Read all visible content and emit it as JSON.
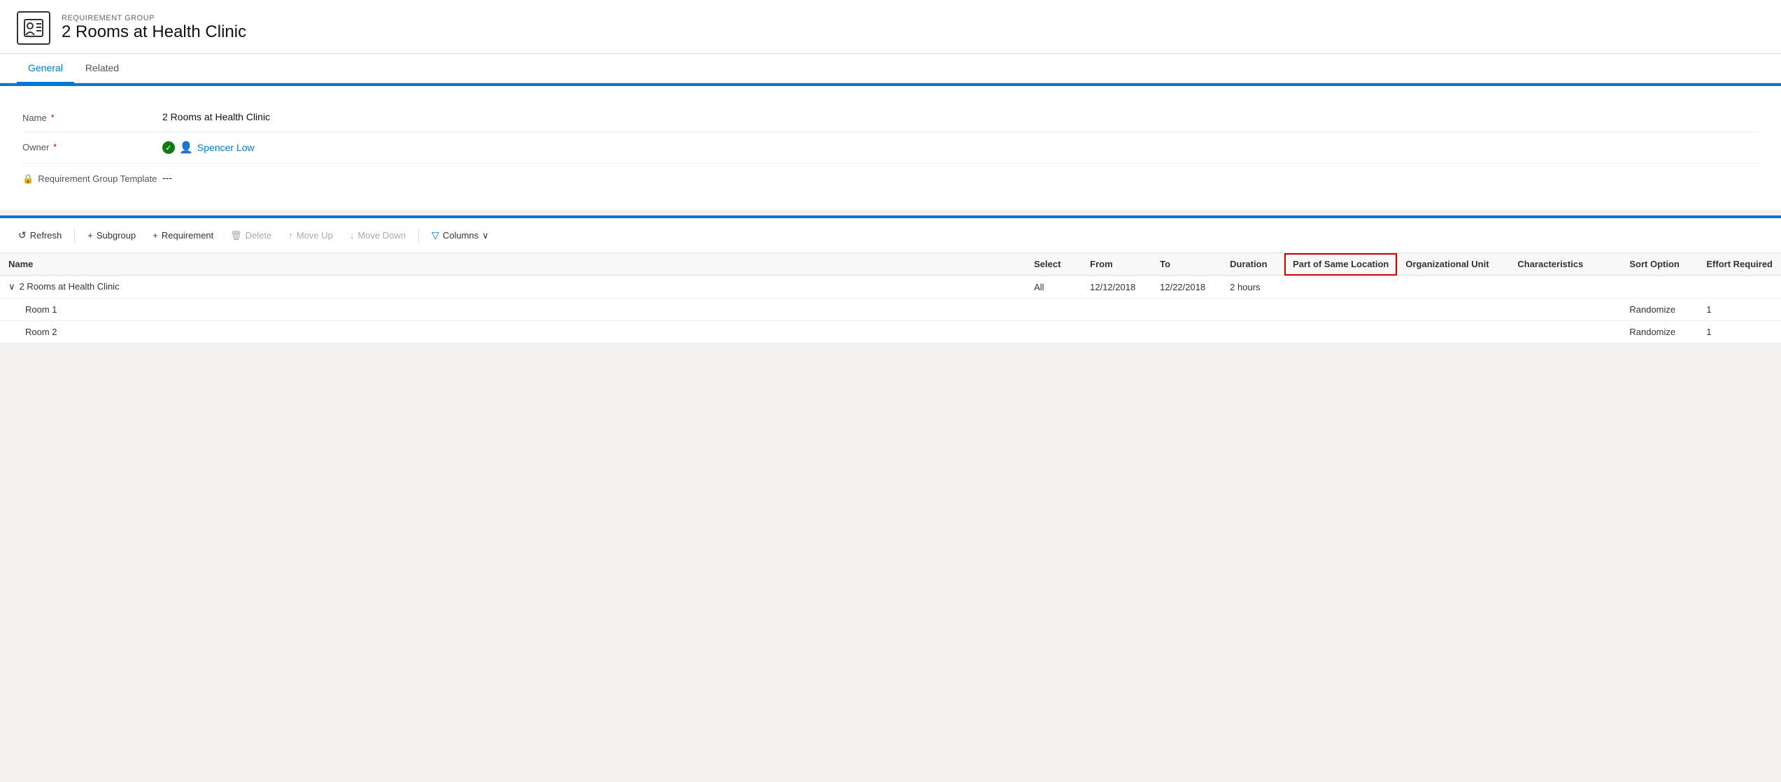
{
  "header": {
    "subtitle": "REQUIREMENT GROUP",
    "title": "2 Rooms at Health Clinic"
  },
  "tabs": [
    {
      "label": "General",
      "active": true
    },
    {
      "label": "Related",
      "active": false
    }
  ],
  "form": {
    "fields": [
      {
        "label": "Name",
        "required": true,
        "lock": false,
        "value": "2 Rooms at Health Clinic",
        "type": "text"
      },
      {
        "label": "Owner",
        "required": true,
        "lock": false,
        "value": "Spencer Low",
        "type": "link"
      },
      {
        "label": "Requirement Group Template",
        "required": false,
        "lock": true,
        "value": "---",
        "type": "text"
      }
    ]
  },
  "toolbar": {
    "refresh_label": "Refresh",
    "subgroup_label": "Subgroup",
    "requirement_label": "Requirement",
    "delete_label": "Delete",
    "moveup_label": "Move Up",
    "movedown_label": "Move Down",
    "columns_label": "Columns"
  },
  "grid": {
    "columns": [
      {
        "id": "name",
        "label": "Name",
        "highlighted": false
      },
      {
        "id": "select",
        "label": "Select",
        "highlighted": false
      },
      {
        "id": "from",
        "label": "From",
        "highlighted": false
      },
      {
        "id": "to",
        "label": "To",
        "highlighted": false
      },
      {
        "id": "duration",
        "label": "Duration",
        "highlighted": false
      },
      {
        "id": "partofsame",
        "label": "Part of Same Location",
        "highlighted": true
      },
      {
        "id": "orgunit",
        "label": "Organizational Unit",
        "highlighted": false
      },
      {
        "id": "characteristics",
        "label": "Characteristics",
        "highlighted": false
      },
      {
        "id": "sortoption",
        "label": "Sort Option",
        "highlighted": false
      },
      {
        "id": "effortrequired",
        "label": "Effort Required",
        "highlighted": false
      }
    ],
    "rows": [
      {
        "name": "2 Rooms at Health Clinic",
        "indent": false,
        "chevron": true,
        "select": "All",
        "from": "12/12/2018",
        "to": "12/22/2018",
        "duration": "2 hours",
        "partofsame": "",
        "orgunit": "",
        "characteristics": "",
        "sortoption": "",
        "effortrequired": ""
      },
      {
        "name": "Room 1",
        "indent": true,
        "chevron": false,
        "select": "",
        "from": "",
        "to": "",
        "duration": "",
        "partofsame": "",
        "orgunit": "",
        "characteristics": "",
        "sortoption": "Randomize",
        "effortrequired": "1"
      },
      {
        "name": "Room 2",
        "indent": true,
        "chevron": false,
        "select": "",
        "from": "",
        "to": "",
        "duration": "",
        "partofsame": "",
        "orgunit": "",
        "characteristics": "",
        "sortoption": "Randomize",
        "effortrequired": "1"
      }
    ]
  }
}
